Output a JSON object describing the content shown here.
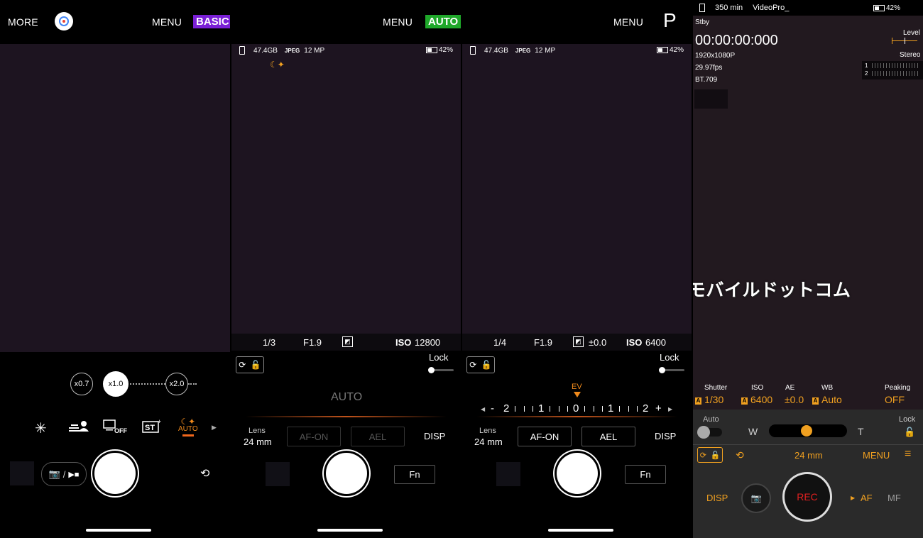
{
  "panel1": {
    "more": "MORE",
    "menu": "MENU",
    "mode": "BASIC",
    "mode_color": "#7a1fd6",
    "zoom": [
      "x0.7",
      "x1.0",
      "x2.0"
    ],
    "scene_auto": "AUTO",
    "photo_video": "/"
  },
  "panel2": {
    "menu": "MENU",
    "mode": "AUTO",
    "mode_color": "#1fa82a",
    "storage": "47.4GB",
    "format": "JPEG",
    "resolution": "12 MP",
    "battery": "42%",
    "shutter": "1/3",
    "aperture": "F1.9",
    "iso_label": "ISO",
    "iso": "12800",
    "lock": "Lock",
    "auto_dial": "AUTO",
    "lens_label": "Lens",
    "lens": "24 mm",
    "af_on": "AF-ON",
    "ael": "AEL",
    "disp": "DISP",
    "fn": "Fn"
  },
  "panel3": {
    "menu": "MENU",
    "mode": "P",
    "storage": "47.4GB",
    "format": "JPEG",
    "resolution": "12 MP",
    "battery": "42%",
    "shutter": "1/4",
    "aperture": "F1.9",
    "ev_value": "±0.0",
    "iso_label": "ISO",
    "iso": "6400",
    "lock": "Lock",
    "ev_label": "EV",
    "ev_scale": [
      "-",
      "2",
      "1",
      "0",
      "1",
      "2",
      "+"
    ],
    "lens_label": "Lens",
    "lens": "24 mm",
    "af_on": "AF-ON",
    "ael": "AEL",
    "disp": "DISP",
    "fn": "Fn"
  },
  "panel4": {
    "rec_time": "350 min",
    "app": "VideoPro_",
    "battery": "42%",
    "status": "Stby",
    "timecode": "00:00:00:000",
    "res": "1920x1080P",
    "fps": "29.97fps",
    "color": "BT.709",
    "level": "Level",
    "stereo": "Stereo",
    "ch1": "1",
    "ch2": "2",
    "watermark": "@モバイルドットコム",
    "settings": [
      {
        "label": "Shutter",
        "value": "1/30",
        "auto": true
      },
      {
        "label": "ISO",
        "value": "6400",
        "auto": true
      },
      {
        "label": "AE",
        "value": "±0.0",
        "auto": false
      },
      {
        "label": "WB",
        "value": "Auto",
        "auto": true
      },
      {
        "label": "Peaking",
        "value": "OFF",
        "auto": false
      }
    ],
    "auto": "Auto",
    "w": "W",
    "t": "T",
    "lock": "Lock",
    "focal": "24 mm",
    "menu": "MENU",
    "disp": "DISP",
    "rec": "REC",
    "af": "AF",
    "mf": "MF",
    "accent": "#f0a020"
  }
}
